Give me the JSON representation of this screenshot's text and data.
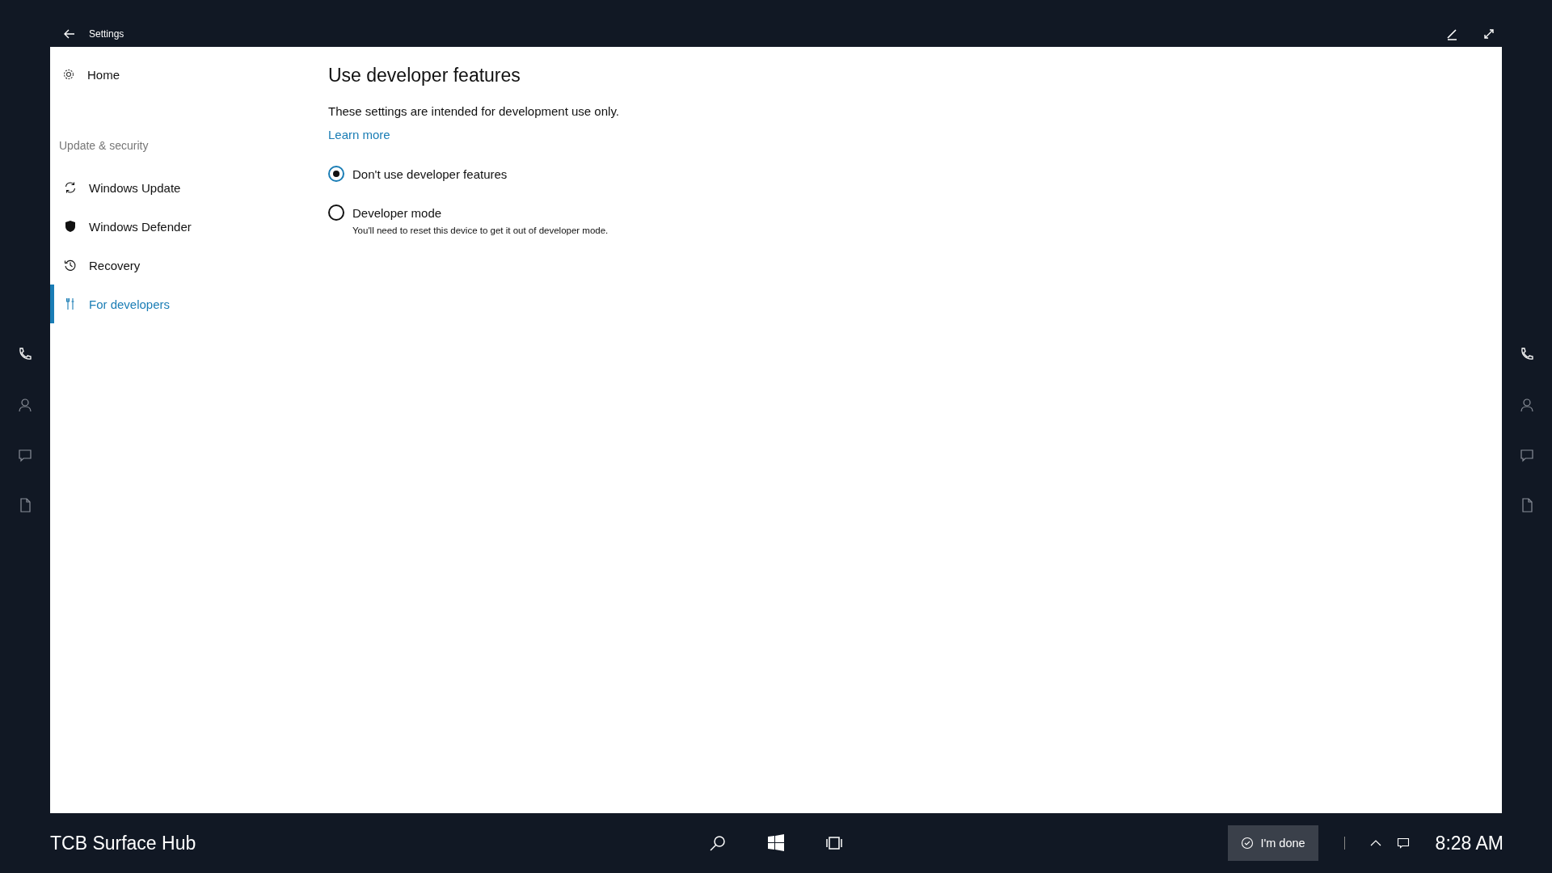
{
  "window": {
    "title": "Settings"
  },
  "sidebar": {
    "home": "Home",
    "section": "Update & security",
    "items": [
      {
        "label": "Windows Update",
        "selected": false
      },
      {
        "label": "Windows Defender",
        "selected": false
      },
      {
        "label": "Recovery",
        "selected": false
      },
      {
        "label": "For developers",
        "selected": true
      }
    ]
  },
  "content": {
    "heading": "Use developer features",
    "description": "These settings are intended for development use only.",
    "link": "Learn more",
    "options": [
      {
        "label": "Don't use developer features",
        "selected": true
      },
      {
        "label": "Developer mode",
        "note": "You'll need to reset this device to get it out of developer mode.",
        "selected": false
      }
    ]
  },
  "taskbar": {
    "device_name": "TCB Surface Hub",
    "done_button": "I'm done",
    "clock": "8:28 AM"
  }
}
